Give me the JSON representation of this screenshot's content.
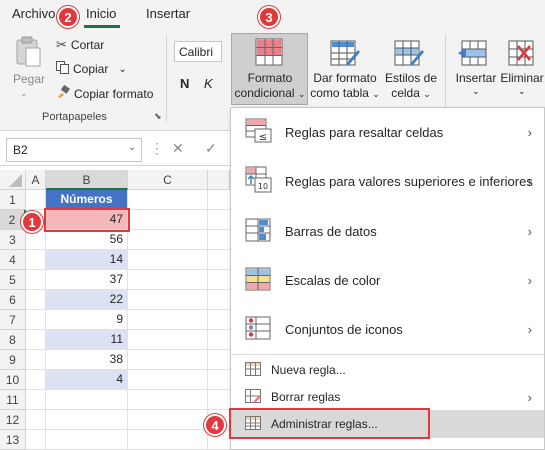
{
  "ribbon": {
    "tabs": [
      "Archivo",
      "Inicio",
      "Insertar"
    ],
    "clipboard": {
      "paste_label": "Pegar",
      "cut_label": "Cortar",
      "copy_label": "Copiar",
      "format_painter_label": "Copiar formato",
      "group_label": "Portapapeles"
    },
    "font": {
      "name": "Calibri",
      "bold": "N",
      "italic": "K"
    },
    "styles": {
      "conditional_format_line1": "Formato",
      "conditional_format_line2": "condicional",
      "format_table_line1": "Dar formato",
      "format_table_line2": "como tabla",
      "cell_styles_line1": "Estilos de",
      "cell_styles_line2": "celda"
    },
    "cells": {
      "insert_label": "Insertar",
      "delete_label": "Eliminar"
    }
  },
  "formula_bar": {
    "name_box": "B2",
    "cancel": "✕",
    "confirm": "✓"
  },
  "sheet": {
    "columns": [
      "A",
      "B",
      "C"
    ],
    "rows": [
      "1",
      "2",
      "3",
      "4",
      "5",
      "6",
      "7",
      "8",
      "9",
      "10",
      "11",
      "12",
      "13"
    ],
    "header_cell": "Números",
    "values": [
      "47",
      "56",
      "14",
      "37",
      "22",
      "9",
      "11",
      "38",
      "4"
    ]
  },
  "menu": {
    "items": [
      "Reglas para resaltar celdas",
      "Reglas para valores superiores e inferiores",
      "Barras de datos",
      "Escalas de color",
      "Conjuntos de iconos"
    ],
    "new_rule": "Nueva regla...",
    "clear_rules": "Borrar reglas",
    "manage_rules": "Administrar reglas..."
  },
  "callouts": [
    "1",
    "2",
    "3",
    "4"
  ],
  "colors": {
    "accent": "#217346",
    "highlight": "#e1393b",
    "table_header": "#4472c4",
    "table_band": "#dbe2f3"
  }
}
